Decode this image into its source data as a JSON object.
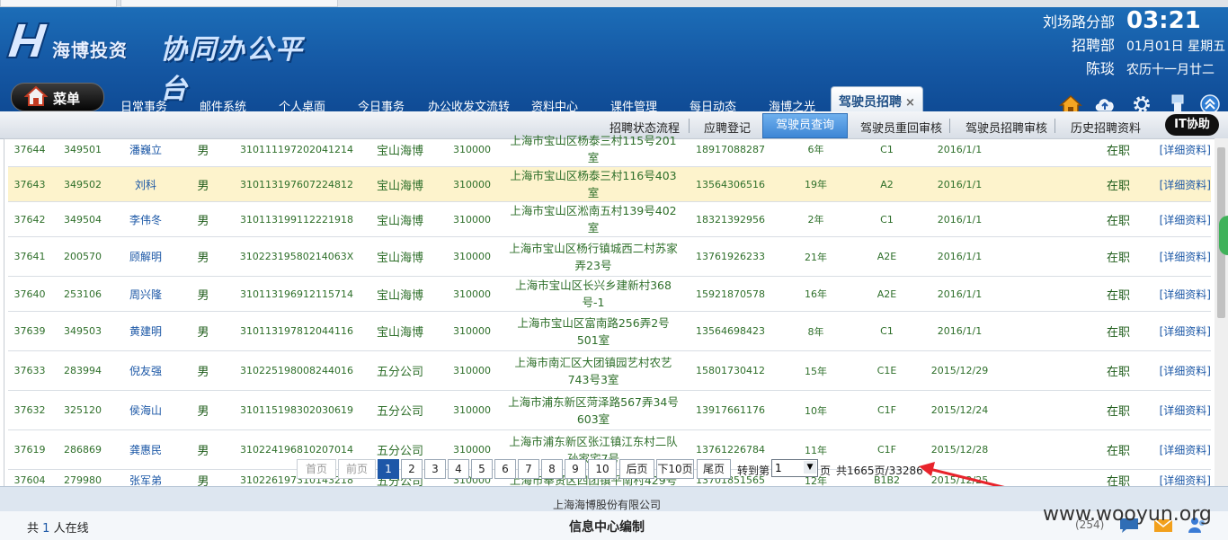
{
  "header": {
    "company_name": "海博投资",
    "platform_title": "协同办公平台",
    "branch": "刘场路分部",
    "department": "招聘部",
    "user": "陈琰",
    "time": "03:21",
    "date": "01月01日 星期五",
    "lunar_date": "农历十一月廿二"
  },
  "menu_button": "菜单",
  "nav_tabs": [
    {
      "label": "日常事务"
    },
    {
      "label": "邮件系统"
    },
    {
      "label": "个人桌面"
    },
    {
      "label": "今日事务"
    },
    {
      "label": "办公收发文流转"
    },
    {
      "label": "资料中心"
    },
    {
      "label": "课件管理"
    },
    {
      "label": "每日动态"
    },
    {
      "label": "海博之光"
    }
  ],
  "active_tab": {
    "label": "驾驶员招聘",
    "close": "×"
  },
  "toolbar_icons": [
    "home-icon",
    "cloud-upload-icon",
    "gear-icon",
    "usb-icon",
    "scroll-top-icon"
  ],
  "sub_tabs": [
    {
      "label": "招聘状态流程"
    },
    {
      "label": "应聘登记"
    },
    {
      "label": "驾驶员查询"
    },
    {
      "label": "驾驶员重回审核"
    },
    {
      "label": "驾驶员招聘审核"
    },
    {
      "label": "历史招聘资料"
    }
  ],
  "it_help": "IT协助",
  "rows": [
    {
      "id": "37644",
      "code": "349501",
      "name": "潘巍立",
      "gender": "男",
      "idcard": "310111197202041214",
      "company": "宝山海博",
      "zip": "310000",
      "address": "上海市宝山区杨泰三村115号201室",
      "phone": "18917088287",
      "years": "6年",
      "license": "C1",
      "date": "2016/1/1",
      "status": "在职",
      "detail": "[详细资料]"
    },
    {
      "id": "37643",
      "code": "349502",
      "name": "刘科",
      "gender": "男",
      "idcard": "310113197607224812",
      "company": "宝山海博",
      "zip": "310000",
      "address": "上海市宝山区杨泰三村116号403室",
      "phone": "13564306516",
      "years": "19年",
      "license": "A2",
      "date": "2016/1/1",
      "status": "在职",
      "detail": "[详细资料]"
    },
    {
      "id": "37642",
      "code": "349504",
      "name": "李伟冬",
      "gender": "男",
      "idcard": "310113199112221918",
      "company": "宝山海博",
      "zip": "310000",
      "address": "上海市宝山区淞南五村139号402室",
      "phone": "18321392956",
      "years": "2年",
      "license": "C1",
      "date": "2016/1/1",
      "status": "在职",
      "detail": "[详细资料]"
    },
    {
      "id": "37641",
      "code": "200570",
      "name": "顾解明",
      "gender": "男",
      "idcard": "31022319580214063X",
      "company": "宝山海博",
      "zip": "310000",
      "address": "上海市宝山区杨行镇城西二村苏家弄23号",
      "phone": "13761926233",
      "years": "21年",
      "license": "A2E",
      "date": "2016/1/1",
      "status": "在职",
      "detail": "[详细资料]"
    },
    {
      "id": "37640",
      "code": "253106",
      "name": "周兴隆",
      "gender": "男",
      "idcard": "310113196912115714",
      "company": "宝山海博",
      "zip": "310000",
      "address": "上海市宝山区长兴乡建新村368号-1",
      "phone": "15921870578",
      "years": "16年",
      "license": "A2E",
      "date": "2016/1/1",
      "status": "在职",
      "detail": "[详细资料]"
    },
    {
      "id": "37639",
      "code": "349503",
      "name": "黄建明",
      "gender": "男",
      "idcard": "310113197812044116",
      "company": "宝山海博",
      "zip": "310000",
      "address": "上海市宝山区富南路256弄2号501室",
      "phone": "13564698423",
      "years": "8年",
      "license": "C1",
      "date": "2016/1/1",
      "status": "在职",
      "detail": "[详细资料]"
    },
    {
      "id": "37633",
      "code": "283994",
      "name": "倪友强",
      "gender": "男",
      "idcard": "310225198008244016",
      "company": "五分公司",
      "zip": "310000",
      "address": "上海市南汇区大团镇园艺村农艺743号3室",
      "phone": "15801730412",
      "years": "15年",
      "license": "C1E",
      "date": "2015/12/29",
      "status": "在职",
      "detail": "[详细资料]"
    },
    {
      "id": "37632",
      "code": "325120",
      "name": "侯海山",
      "gender": "男",
      "idcard": "310115198302030619",
      "company": "五分公司",
      "zip": "310000",
      "address": "上海市浦东新区菏泽路567弄34号603室",
      "phone": "13917661176",
      "years": "10年",
      "license": "C1F",
      "date": "2015/12/24",
      "status": "在职",
      "detail": "[详细资料]"
    },
    {
      "id": "37619",
      "code": "286869",
      "name": "龚惠民",
      "gender": "男",
      "idcard": "310224196810207014",
      "company": "五分公司",
      "zip": "310000",
      "address": "上海市浦东新区张江镇江东村二队孙家宅7号",
      "phone": "13761226784",
      "years": "11年",
      "license": "C1F",
      "date": "2015/12/28",
      "status": "在职",
      "detail": "[详细资料]"
    },
    {
      "id": "37604",
      "code": "279980",
      "name": "张军弟",
      "gender": "男",
      "idcard": "310226197310143218",
      "company": "五分公司",
      "zip": "310000",
      "address": "上海市奉贤区四团镇平南村429号",
      "phone": "13701851565",
      "years": "12年",
      "license": "B1B2",
      "date": "2015/12/25",
      "status": "在职",
      "detail": "[详细资料]"
    }
  ],
  "pager": {
    "first": "首页",
    "prev": "前页",
    "pages": [
      "1",
      "2",
      "3",
      "4",
      "5",
      "6",
      "7",
      "8",
      "9",
      "10"
    ],
    "current": "1",
    "next": "后页",
    "next10": "下10页",
    "last": "尾页",
    "goto_label": "转到第",
    "goto_value": "1",
    "page_unit": "页",
    "summary": "共1665页/33286"
  },
  "footer": {
    "company": "上海海博股份有限公司",
    "online_prefix": "共",
    "online_count": "1",
    "online_suffix": "人在线",
    "credit": "信息中心编制",
    "notify_count": "(254)"
  },
  "watermark": "www.wooyun.org",
  "colors": {
    "header_blue": "#1558a4",
    "active_subtab": "#3d86d5",
    "highlight_row": "#fdf3cc",
    "text_green": "#2e6f2a",
    "link_blue": "#1b57a6",
    "annotation_red": "#e8232b"
  }
}
